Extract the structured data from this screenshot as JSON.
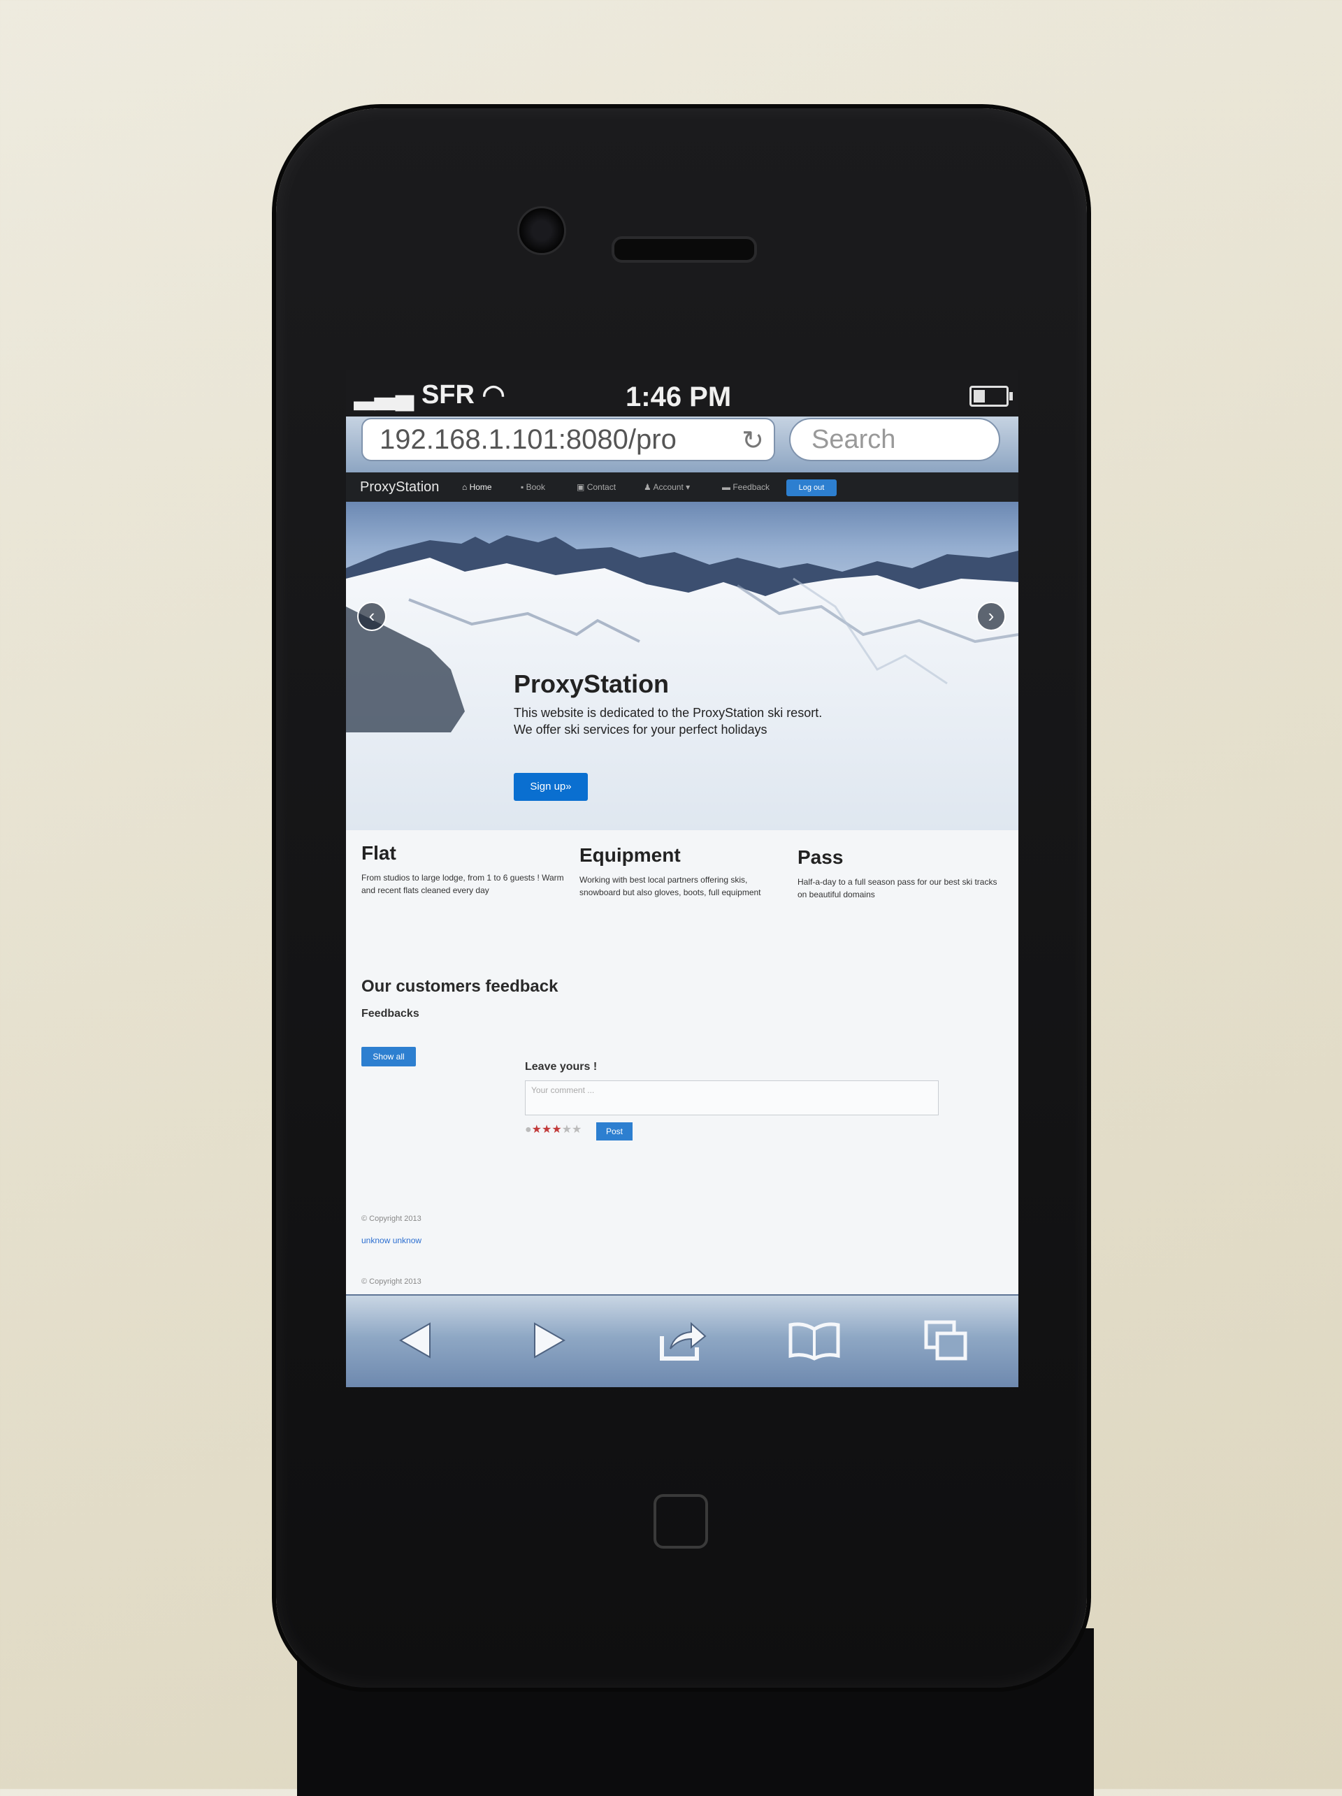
{
  "status_bar": {
    "carrier": "SFR",
    "time": "1:46 PM"
  },
  "browser": {
    "url": "192.168.1.101:8080/pro",
    "search_placeholder": "Search"
  },
  "navbar": {
    "brand": "ProxyStation",
    "items": [
      {
        "icon": "home-icon",
        "label": "Home"
      },
      {
        "icon": "book-icon",
        "label": "Book"
      },
      {
        "icon": "contact-icon",
        "label": "Contact"
      },
      {
        "icon": "user-icon",
        "label": "Account"
      },
      {
        "icon": "comment-icon",
        "label": "Feedback"
      }
    ],
    "logout": "Log out"
  },
  "hero": {
    "title": "ProxyStation",
    "text": "This website is dedicated to the ProxyStation ski resort. We offer ski services for your perfect holidays",
    "button": "Sign up»"
  },
  "columns": [
    {
      "title": "Flat",
      "text": "From studios to large lodge, from 1 to 6 guests ! Warm and recent flats cleaned every day"
    },
    {
      "title": "Equipment",
      "text": "Working with best local partners offering skis, snowboard but also gloves, boots, full equipment"
    },
    {
      "title": "Pass",
      "text": "Half-a-day to a full season pass for our best ski tracks on beautiful domains"
    }
  ],
  "feedback": {
    "title": "Our customers feedback",
    "subtitle": "Feedbacks",
    "show_all": "Show all",
    "leave_label": "Leave yours !",
    "comment_placeholder": "Your comment ...",
    "rating": 3,
    "rating_max": 5,
    "post": "Post"
  },
  "footer": {
    "copyright": "© Copyright 2013",
    "link": "unknow unknow",
    "copyright_bottom": "© Copyright 2013"
  },
  "toolbar": {
    "icons": [
      "back-icon",
      "forward-icon",
      "share-icon",
      "bookmarks-icon",
      "tabs-icon"
    ]
  }
}
